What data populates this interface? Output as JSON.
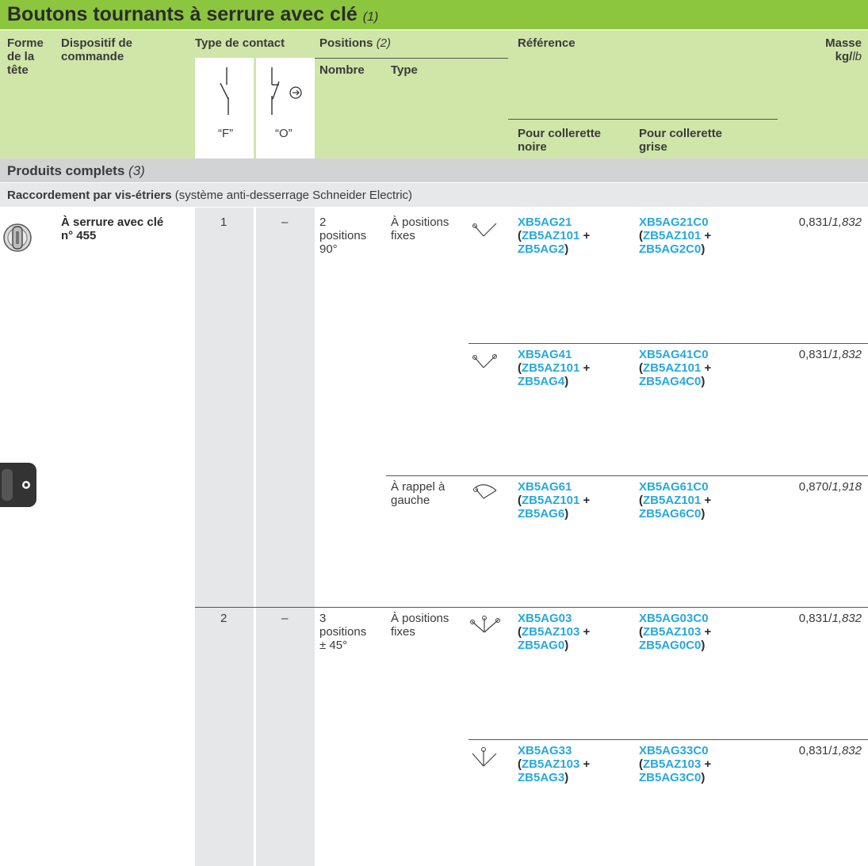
{
  "title": "Boutons tournants à serrure avec clé",
  "title_note": "(1)",
  "header": {
    "forme": "Forme de la tête",
    "dispositif": "Dispositif de commande",
    "type_contact": "Type de contact",
    "contact_f": "“F”",
    "contact_o": "“O”",
    "positions": "Positions",
    "positions_note": "(2)",
    "nombre": "Nombre",
    "type": "Type",
    "reference": "Référence",
    "ref_noire": "Pour collerette noire",
    "ref_grise": "Pour collerette grise",
    "masse": "Masse",
    "masse_unit_kg": "kg/",
    "masse_unit_lb": "lb"
  },
  "section": {
    "label": "Produits complets",
    "note": "(3)"
  },
  "subsection": {
    "label": "Raccordement par vis-étriers",
    "note": "(système anti-desserrage Schneider Electric)"
  },
  "device": "À serrure avec clé n° 455",
  "groups": [
    {
      "f": "1",
      "o": "–",
      "positions": "2 positions 90°"
    },
    {
      "f": "2",
      "o": "–",
      "positions": "3 positions ± 45°"
    }
  ],
  "rows": [
    {
      "type": "À positions fixes",
      "ref1": "XB5AG21",
      "ref1_a": "ZB5AZ101",
      "ref1_b": "ZB5AG2",
      "ref2": "XB5AG21C0",
      "ref2_a": "ZB5AZ101",
      "ref2_b": "ZB5AG2C0",
      "kg": "0,831/",
      "lb": "1,832"
    },
    {
      "type": "",
      "ref1": "XB5AG41",
      "ref1_a": "ZB5AZ101",
      "ref1_b": "ZB5AG4",
      "ref2": "XB5AG41C0",
      "ref2_a": "ZB5AZ101",
      "ref2_b": "ZB5AG4C0",
      "kg": "0,831/",
      "lb": "1,832"
    },
    {
      "type": "À rappel à gauche",
      "ref1": "XB5AG61",
      "ref1_a": "ZB5AZ101",
      "ref1_b": "ZB5AG6",
      "ref2": "XB5AG61C0",
      "ref2_a": "ZB5AZ101",
      "ref2_b": "ZB5AG6C0",
      "kg": "0,870/",
      "lb": "1,918"
    },
    {
      "type": "À positions fixes",
      "ref1": "XB5AG03",
      "ref1_a": "ZB5AZ103",
      "ref1_b": "ZB5AG0",
      "ref2": "XB5AG03C0",
      "ref2_a": "ZB5AZ103",
      "ref2_b": "ZB5AG0C0",
      "kg": "0,831/",
      "lb": "1,832"
    },
    {
      "type": "",
      "ref1": "XB5AG33",
      "ref1_a": "ZB5AZ103",
      "ref1_b": "ZB5AG3",
      "ref2": "XB5AG33C0",
      "ref2_a": "ZB5AZ103",
      "ref2_b": "ZB5AG3C0",
      "kg": "0,831/",
      "lb": "1,832"
    }
  ],
  "plus": "+",
  "open_paren": "(",
  "close_paren": ")"
}
